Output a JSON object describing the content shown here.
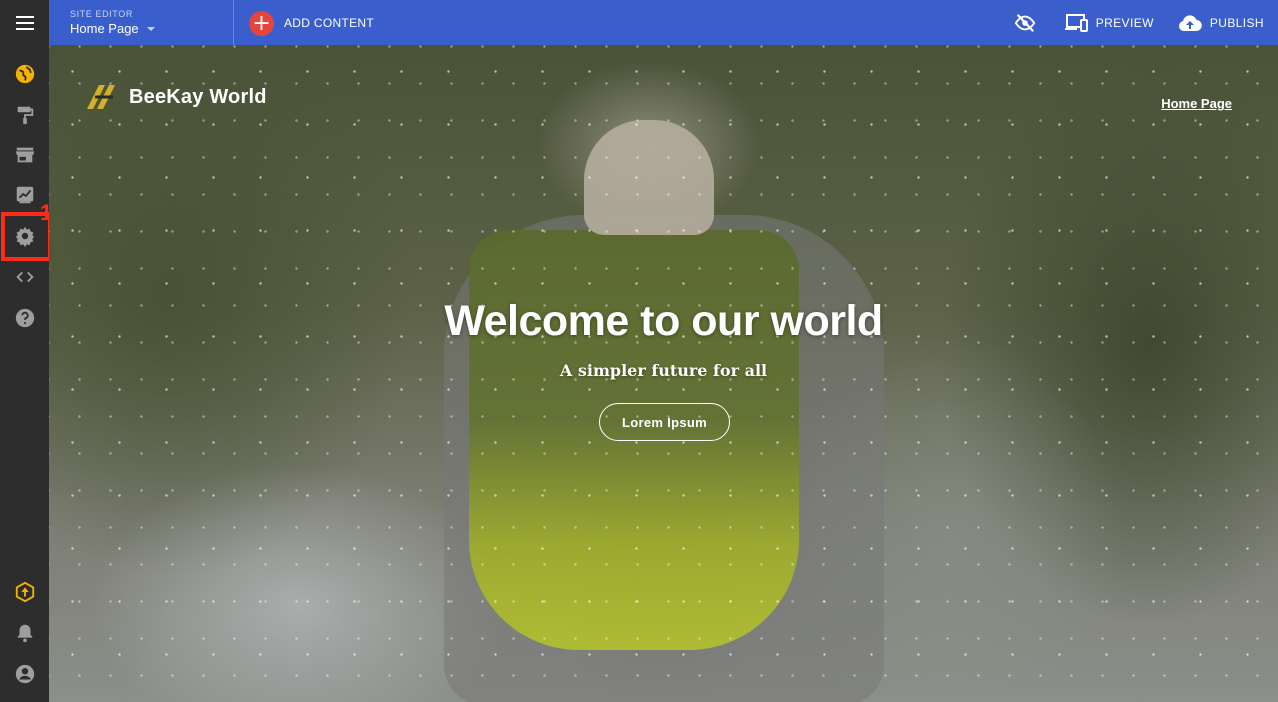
{
  "topbar": {
    "site_editor_label": "SITE EDITOR",
    "current_page": "Home Page",
    "add_content_label": "ADD CONTENT",
    "preview_label": "PREVIEW",
    "publish_label": "PUBLISH"
  },
  "sidebar": {
    "items": [
      {
        "icon": "globe-icon"
      },
      {
        "icon": "paint-roller-icon"
      },
      {
        "icon": "store-icon"
      },
      {
        "icon": "chart-icon"
      },
      {
        "icon": "gear-icon"
      },
      {
        "icon": "code-icon"
      },
      {
        "icon": "help-icon"
      }
    ],
    "bottom_items": [
      {
        "icon": "upgrade-icon"
      },
      {
        "icon": "bell-icon"
      },
      {
        "icon": "account-icon"
      }
    ]
  },
  "annotation": {
    "number": "1"
  },
  "site": {
    "brand_name": "BeeKay World",
    "nav_link": "Home Page",
    "hero_title": "Welcome to our world",
    "hero_subtitle": "A simpler future for all",
    "hero_button": "Lorem Ipsum"
  },
  "colors": {
    "topbar": "#3a5fcd",
    "sidebar": "#2d2d2d",
    "accent_yellow": "#f5b301",
    "add_button": "#e5453a",
    "highlight": "#ff2a1a"
  }
}
